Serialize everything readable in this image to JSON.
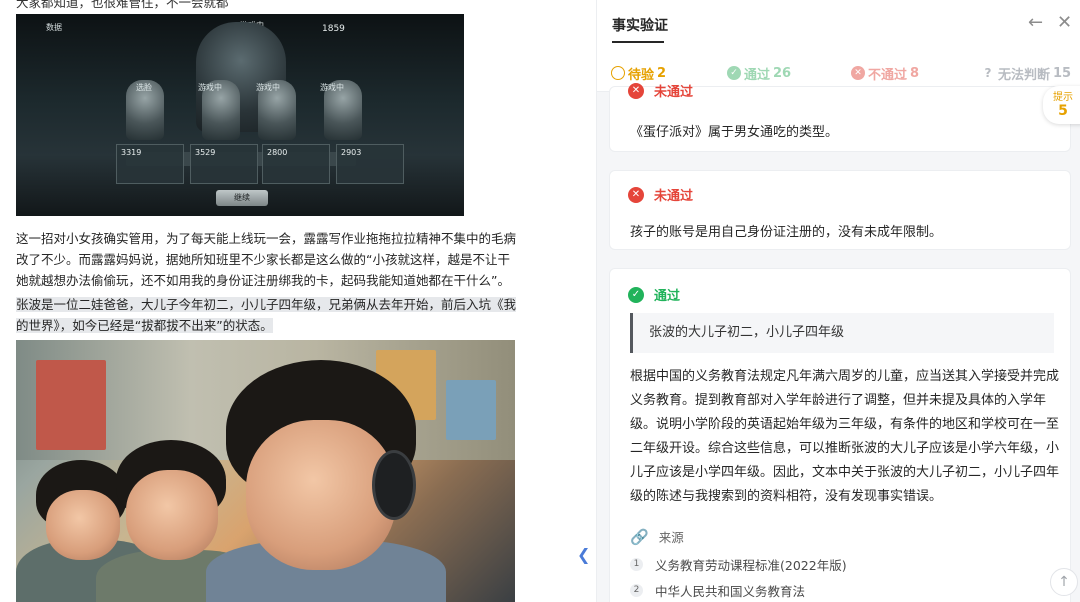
{
  "article": {
    "top_cut_text": "大家都知道，也很难管住，不一会就都",
    "game_screenshot": {
      "corner_label": "数据",
      "status_label": "游戏中",
      "score_top": "1859",
      "slot_labels": [
        "选脸",
        "游戏中",
        "游戏中",
        "游戏中"
      ],
      "panel_values": [
        "3319",
        "3529",
        "2800",
        "2903"
      ],
      "button_label": "继续"
    },
    "paragraph_1": "这一招对小女孩确实管用，为了每天能上线玩一会，露露写作业拖拖拉拉精神不集中的毛病改了不少。而露露妈妈说，据她所知班里不少家长都是这么做的“小孩就这样，越是不让干她就越想办法偷偷玩，还不如用我的身份证注册绑我的卡，起码我能知道她都在干什么”。",
    "paragraph_2": "张波是一位二娃爸爸，大儿子今年初二，小儿子四年级，兄弟俩从去年开始，前后入坑《我的世界》，如今已经是“拔都拔不出来”的状态。"
  },
  "panel": {
    "title": "事实验证",
    "filters": {
      "pending": {
        "label": "待验",
        "count": "2"
      },
      "pass": {
        "label": "通过",
        "count": "26"
      },
      "fail": {
        "label": "不通过",
        "count": "8"
      },
      "unknown": {
        "label": "无法判断",
        "count": "15"
      }
    },
    "hint": {
      "label": "提示",
      "count": "5"
    },
    "cards": [
      {
        "status": "未通过",
        "text": "《蛋仔派对》属于男女通吃的类型。"
      },
      {
        "status": "未通过",
        "text": "孩子的账号是用自己身份证注册的，没有未成年限制。"
      },
      {
        "status": "通过",
        "quote": "张波的大儿子初二，小儿子四年级",
        "explanation": "根据中国的义务教育法规定凡年满六周岁的儿童，应当送其入学接受并完成义务教育。提到教育部对入学年龄进行了调整，但并未提及具体的入学年级。说明小学阶段的英语起始年级为三年级，有条件的地区和学校可在一至二年级开设。综合这些信息，可以推断张波的大儿子应该是小学六年级，小儿子应该是小学四年级。因此，文本中关于张波的大儿子初二，小儿子四年级的陈述与我搜索到的资料相符，没有发现事实错误。",
        "source_label": "来源",
        "sources": [
          {
            "num": "1",
            "title": "义务教育劳动课程标准(2022年版)"
          },
          {
            "num": "2",
            "title": "中华人民共和国义务教育法"
          }
        ]
      }
    ]
  },
  "icons": {
    "back": "arrow-left-icon",
    "close": "close-icon",
    "collapse": "chevron-left-icon",
    "link": "link-icon",
    "scroll_top": "arrow-up-icon"
  },
  "colors": {
    "pending": "#e6a100",
    "pass": "#21b35b",
    "fail": "#e5453a",
    "unknown": "#b8bcc2"
  }
}
